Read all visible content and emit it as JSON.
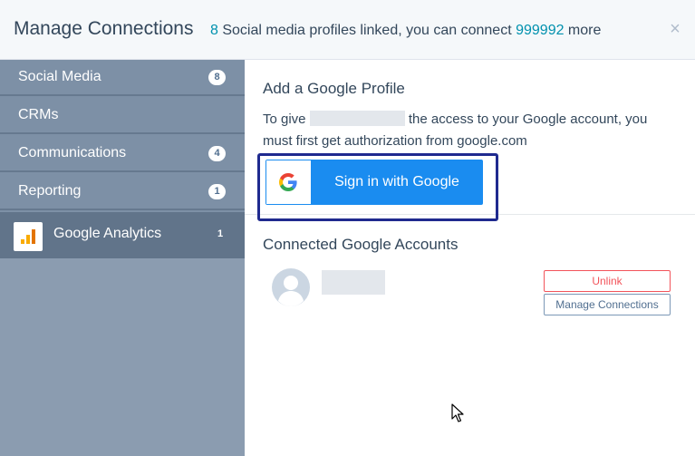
{
  "header": {
    "title": "Manage Connections",
    "linked_count": "8",
    "summary_middle": " Social media profiles linked, you can connect ",
    "remaining_count": "999992",
    "summary_end": " more",
    "close_glyph": "×"
  },
  "sidebar": {
    "items": [
      {
        "label": "Social Media",
        "badge": "8"
      },
      {
        "label": "CRMs",
        "badge": ""
      },
      {
        "label": "Communications",
        "badge": "4"
      },
      {
        "label": "Reporting",
        "badge": "1"
      }
    ],
    "sub_item": {
      "label": "Google Analytics",
      "count": "1",
      "icon": "google-analytics-icon"
    }
  },
  "main": {
    "add_title": "Add a Google Profile",
    "desc_before": "To give ",
    "desc_after": " the access to your Google account, you must first get authorization from google.com",
    "signin_label": "Sign in with Google",
    "connected_title": "Connected Google Accounts",
    "unlink_label": "Unlink",
    "manage_label": "Manage Connections"
  },
  "colors": {
    "accent": "#0091ae",
    "google_button": "#1a8cf0",
    "sidebar": "#7d90a6",
    "sidebar_active": "#61748a",
    "danger": "#f2545b",
    "highlight": "#1f2a8f"
  }
}
